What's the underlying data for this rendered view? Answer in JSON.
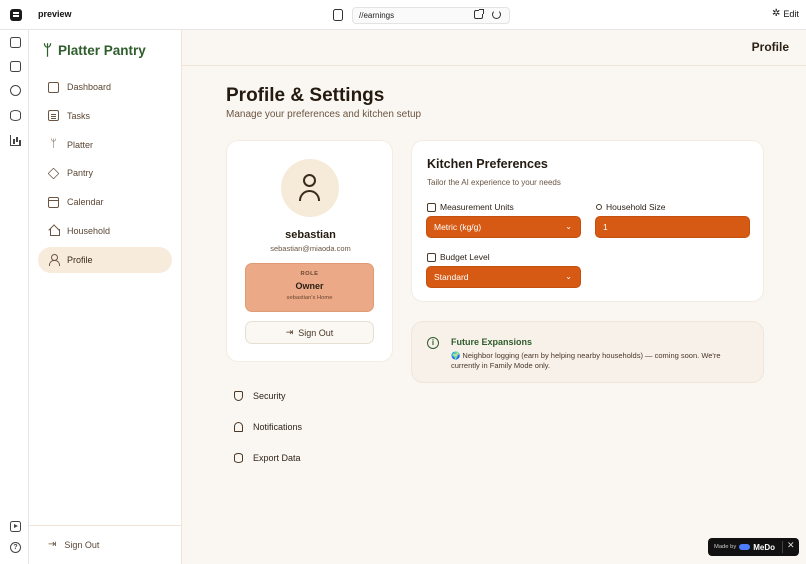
{
  "browser": {
    "title": "preview",
    "url": "//earnings",
    "edit_label": "Edit"
  },
  "rail": {
    "icons": [
      "app-menu-icon",
      "file-icon",
      "chat-icon",
      "cloud-icon",
      "database-icon",
      "chart-icon",
      "play-icon",
      "help-icon"
    ]
  },
  "brand": {
    "name": "Platter Pantry",
    "icon": "fork-knife-icon",
    "color": "#2f5d2c"
  },
  "sidebar": {
    "items": [
      {
        "label": "Dashboard",
        "icon": "grid-icon"
      },
      {
        "label": "Tasks",
        "icon": "clipboard-icon"
      },
      {
        "label": "Platter",
        "icon": "utensils-icon"
      },
      {
        "label": "Pantry",
        "icon": "cube-icon"
      },
      {
        "label": "Calendar",
        "icon": "calendar-icon"
      },
      {
        "label": "Household",
        "icon": "home-icon"
      },
      {
        "label": "Profile",
        "icon": "user-icon",
        "active": true
      }
    ],
    "signout_label": "Sign Out"
  },
  "header": {
    "title": "Profile"
  },
  "page": {
    "title": "Profile & Settings",
    "subtitle": "Manage your preferences and kitchen setup"
  },
  "profile": {
    "name": "sebastian",
    "email": "sebastian@miaoda.com",
    "role_label": "ROLE",
    "role_value": "Owner",
    "household": "sebastian's Home",
    "signout_label": "Sign Out"
  },
  "links": [
    {
      "label": "Security",
      "icon": "shield-icon"
    },
    {
      "label": "Notifications",
      "icon": "bell-icon"
    },
    {
      "label": "Export Data",
      "icon": "database-icon"
    }
  ],
  "preferences": {
    "title": "Kitchen Preferences",
    "subtitle": "Tailor the AI experience to your needs",
    "measurement_label": "Measurement Units",
    "measurement_value": "Metric (kg/g)",
    "household_size_label": "Household Size",
    "household_size_value": "1",
    "budget_label": "Budget Level",
    "budget_value": "Standard"
  },
  "future": {
    "title": "Future Expansions",
    "text": "🌍 Neighbor logging (earn by helping nearby households) — coming soon. We're currently in Family Mode only."
  },
  "badge": {
    "made_by": "Made by",
    "brand": "MeDo",
    "close": "✕"
  },
  "colors": {
    "accent": "#d65a14",
    "brand_green": "#2f5d2c",
    "background": "#faf7f2",
    "role_bg": "#eba987"
  }
}
